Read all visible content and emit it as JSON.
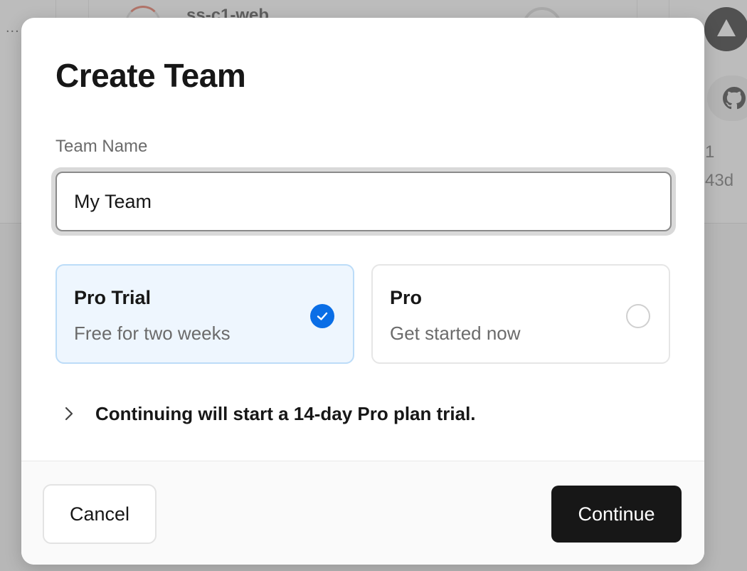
{
  "background": {
    "menu_dots": "...",
    "project_name": "ss-c1-web",
    "meta_line_1": "1",
    "meta_line_2": "43d"
  },
  "modal": {
    "title": "Create Team",
    "team_name": {
      "label": "Team Name",
      "value": "My Team"
    },
    "plans": [
      {
        "name": "Pro Trial",
        "description": "Free for two weeks",
        "selected": true
      },
      {
        "name": "Pro",
        "description": "Get started now",
        "selected": false
      }
    ],
    "disclosure_text": "Continuing will start a 14-day Pro plan trial.",
    "buttons": {
      "cancel": "Cancel",
      "continue": "Continue"
    }
  },
  "colors": {
    "accent": "#0a6ee6",
    "selected_card_bg": "#eef6fe",
    "primary_button": "#171717"
  },
  "icons": {
    "selected_radio": "check-icon",
    "disclosure": "chevron-right-icon",
    "deploy": "triangle-icon",
    "repo": "github-icon"
  }
}
